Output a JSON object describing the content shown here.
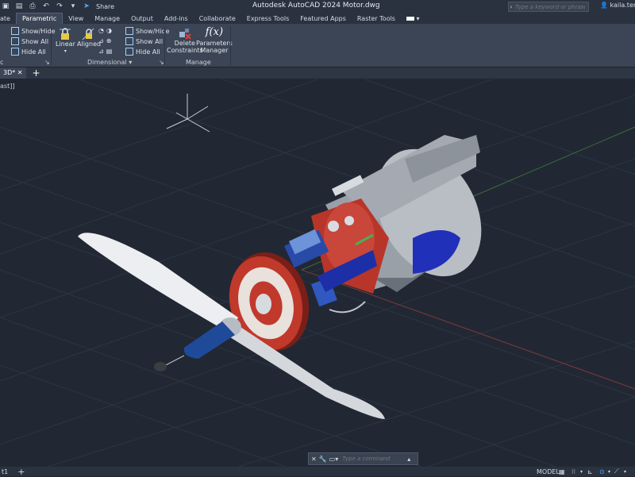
{
  "title_bar": {
    "app_title": "Autodesk AutoCAD 2024   Motor.dwg",
    "share_label": "Share",
    "search_placeholder": "Type a keyword or phrase",
    "user_name": "kaila.tened"
  },
  "ribbon_tabs": [
    "ate",
    "Parametric",
    "View",
    "Manage",
    "Output",
    "Add-ins",
    "Collaborate",
    "Express Tools",
    "Featured Apps",
    "Raster Tools"
  ],
  "active_tab": "Parametric",
  "ribbon": {
    "geometric_panel": {
      "show_hide": "Show/Hide",
      "show_all": "Show All",
      "hide_all": "Hide All",
      "label": "c"
    },
    "dimensional_panel": {
      "linear": "Linear",
      "aligned": "Aligned",
      "show_hide": "Show/Hide",
      "show_all": "Show All",
      "hide_all": "Hide All",
      "label": "Dimensional"
    },
    "manage_panel": {
      "delete_constraints_line1": "Delete",
      "delete_constraints_line2": "Constraints",
      "parameters_manager_line1": "Parameters",
      "parameters_manager_line2": "Manager",
      "label": "Manage",
      "fx_symbol": "f(x)"
    }
  },
  "doc_tabs": {
    "active": "3D*",
    "add": "+"
  },
  "viewport": {
    "label": "ast]]"
  },
  "command_line": {
    "placeholder": "Type a command"
  },
  "status_bar": {
    "layout_tab": "t1",
    "add": "+",
    "model_label": "MODEL"
  },
  "colors": {
    "background": "#212833",
    "ribbon": "#3b4555",
    "accent_red": "#c0392b",
    "accent_blue": "#1f3fb8"
  }
}
